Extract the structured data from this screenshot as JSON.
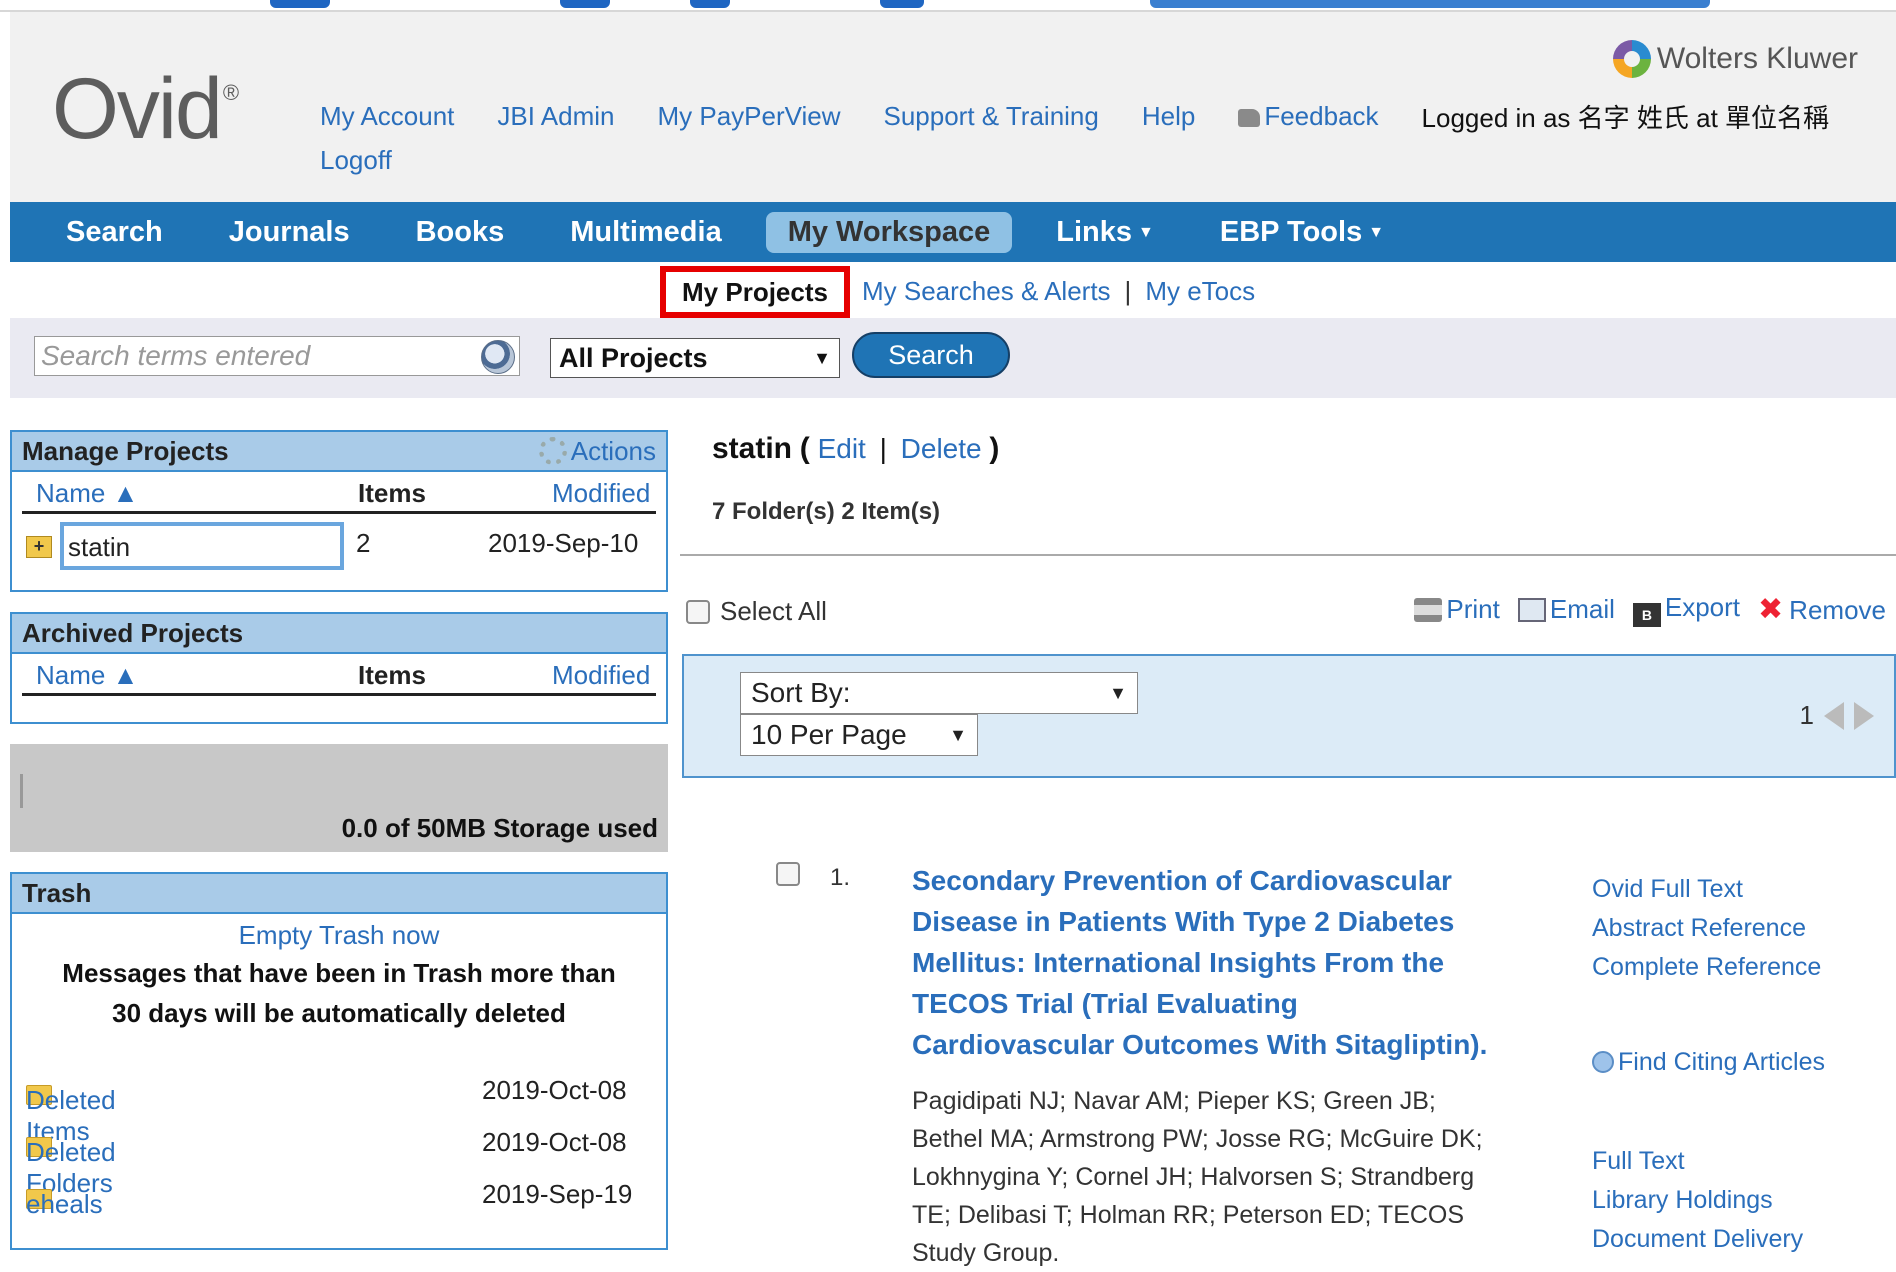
{
  "brand": {
    "logo": "Ovid",
    "logo_mark": "®",
    "publisher": "Wolters Kluwer"
  },
  "toplinks": {
    "my_account": "My Account",
    "jbi_admin": "JBI Admin",
    "my_payperview": "My PayPerView",
    "support": "Support & Training",
    "help": "Help",
    "feedback": "Feedback",
    "logged_in": "Logged in as 名字 姓氏 at 單位名稱",
    "logoff": "Logoff"
  },
  "nav": {
    "search": "Search",
    "journals": "Journals",
    "books": "Books",
    "multimedia": "Multimedia",
    "workspace": "My Workspace",
    "links": "Links",
    "ebp": "EBP Tools"
  },
  "subnav": {
    "my_projects": "My Projects",
    "searches": "My Searches & Alerts",
    "sep": "|",
    "etocs": "My eTocs"
  },
  "search": {
    "placeholder": "Search terms entered",
    "scope": "All Projects",
    "button": "Search"
  },
  "manage": {
    "title": "Manage Projects",
    "actions": "Actions",
    "col_name": "Name ▲",
    "col_items": "Items",
    "col_modified": "Modified",
    "rows": [
      {
        "name": "statin",
        "items": "2",
        "modified": "2019-Sep-10"
      }
    ]
  },
  "archived": {
    "title": "Archived Projects",
    "col_name": "Name ▲",
    "col_items": "Items",
    "col_modified": "Modified"
  },
  "storage": {
    "text": "0.0 of 50MB Storage used",
    "used_fraction": 0.0
  },
  "trash": {
    "title": "Trash",
    "empty": "Empty Trash now",
    "message": "Messages that have been in Trash more than 30 days will be automatically deleted",
    "rows": [
      {
        "name": "Deleted Items",
        "date": "2019-Oct-08"
      },
      {
        "name": "Deleted Folders",
        "date": "2019-Oct-08"
      },
      {
        "name": "eheals",
        "date": "2019-Sep-19"
      }
    ]
  },
  "project": {
    "name": "statin",
    "open_paren": "(",
    "edit": "Edit",
    "sep": "|",
    "delete": "Delete",
    "close_paren": ")",
    "counts": "7 Folder(s) 2 Item(s)"
  },
  "toolbar": {
    "select_all": "Select All",
    "print": "Print",
    "email": "Email",
    "export": "Export",
    "remove": "Remove",
    "export_badge": "B"
  },
  "sort": {
    "sort_by": "Sort By:",
    "per_page": "10 Per Page",
    "page": "1"
  },
  "result": {
    "number": "1.",
    "title": "Secondary Prevention of Cardiovascular Disease in Patients With Type 2 Diabetes Mellitus: International Insights From the TECOS Trial (Trial Evaluating Cardiovascular Outcomes With Sitagliptin).",
    "authors": "Pagidipati NJ; Navar AM; Pieper KS; Green JB; Bethel MA; Armstrong PW; Josse RG; McGuire DK; Lokhnygina Y; Cornel JH; Halvorsen S; Strandberg TE; Delibasi T; Holman RR; Peterson ED; TECOS Study Group.",
    "links": {
      "full_text": "Ovid Full Text",
      "abstract": "Abstract Reference",
      "complete": "Complete Reference",
      "citing": "Find Citing Articles",
      "fulltext2": "Full Text",
      "holdings": "Library Holdings",
      "delivery": "Document Delivery"
    }
  },
  "icons": {
    "dropdown": "▼",
    "caret": "▼",
    "plus": "+",
    "remove": "✖"
  }
}
